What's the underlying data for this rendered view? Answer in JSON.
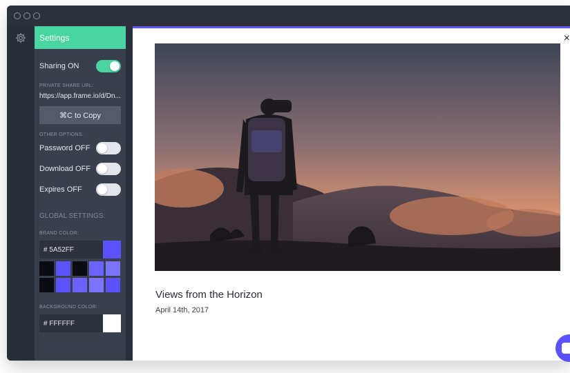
{
  "panel": {
    "header": "Settings",
    "sharing": {
      "label": "Sharing ON",
      "on": true
    },
    "private_share_label": "PRIVATE SHARE URL:",
    "share_url": "https://app.frame.io/d/Dn...",
    "copy_label": "⌘C to Copy",
    "other_options_label": "OTHER OPTIONS:",
    "options": [
      {
        "label": "Password OFF",
        "on": false
      },
      {
        "label": "Download OFF",
        "on": false
      },
      {
        "label": "Expires OFF",
        "on": false
      }
    ],
    "global_settings_label": "GLOBAL SETTINGS:",
    "brand_color_label": "BRAND COLOR:",
    "brand_color_value": "# 5A52FF",
    "brand_color": "#5A52FF",
    "swatches": [
      "#0b0b14",
      "#5a52ff",
      "#0b0b14",
      "#6b63ff",
      "#7a74ff",
      "#0b0b14",
      "#5a52ff",
      "#6b63ff",
      "#7a74ff",
      "#5a52ff"
    ],
    "background_color_label": "BACKGROUND COLOR:",
    "background_color_value": "# FFFFFF",
    "background_color": "#FFFFFF"
  },
  "content": {
    "close_icon": "×",
    "asset_title": "Views from the Horizon",
    "asset_date": "April 14th, 2017"
  },
  "colors": {
    "accent_green": "#49D5A2",
    "accent_purple": "#5A52FF"
  }
}
